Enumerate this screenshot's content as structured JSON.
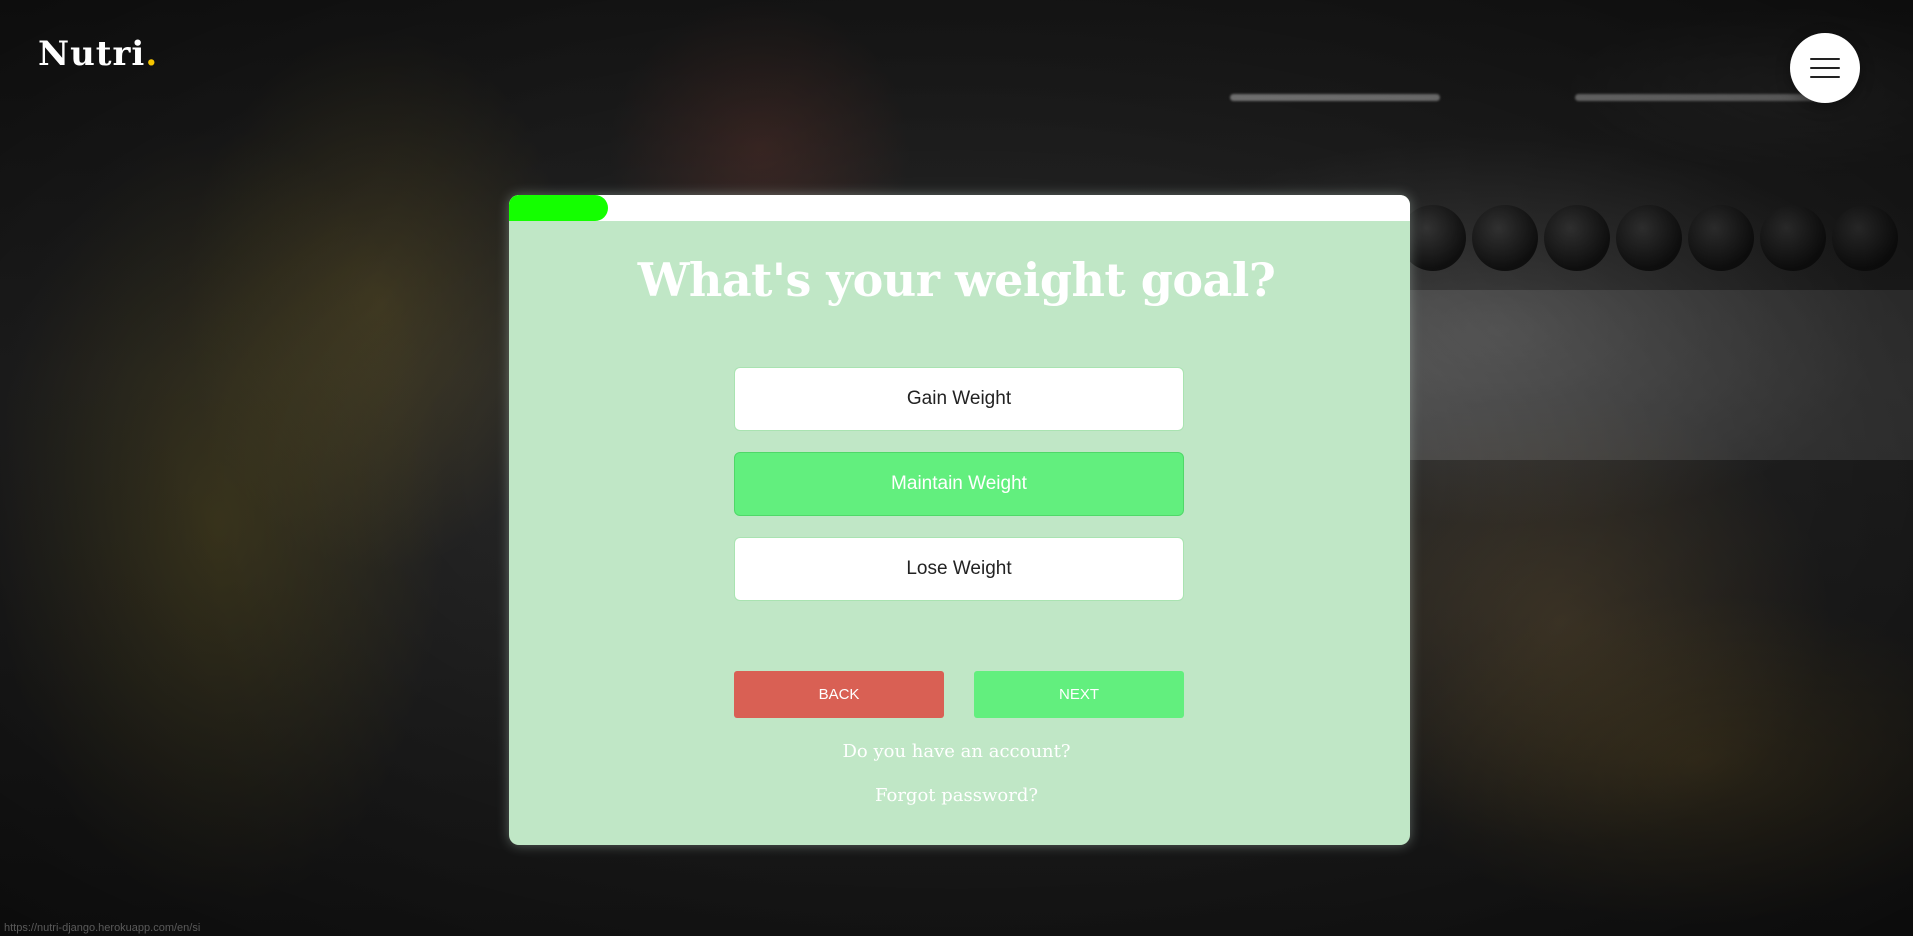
{
  "brand": {
    "name": "Nutri",
    "dot": ".",
    "dot_color": "#f5c400"
  },
  "header": {
    "menu_icon": "hamburger-icon"
  },
  "wizard": {
    "progress_fraction": 0.11,
    "progress_color": "#14ff00",
    "card_color": "#c0e7c6",
    "title": "What's your weight goal?",
    "options": [
      {
        "label": "Gain Weight",
        "selected": false
      },
      {
        "label": "Maintain Weight",
        "selected": true
      },
      {
        "label": "Lose Weight",
        "selected": false
      }
    ],
    "back_label": "BACK",
    "next_label": "NEXT",
    "back_color": "#d96054",
    "next_color": "#62ef7e",
    "account_link": "Do you have an account?",
    "forgot_link": "Forgot password?"
  },
  "status_bar": {
    "url": "https://nutri-django.herokuapp.com/en/si"
  }
}
